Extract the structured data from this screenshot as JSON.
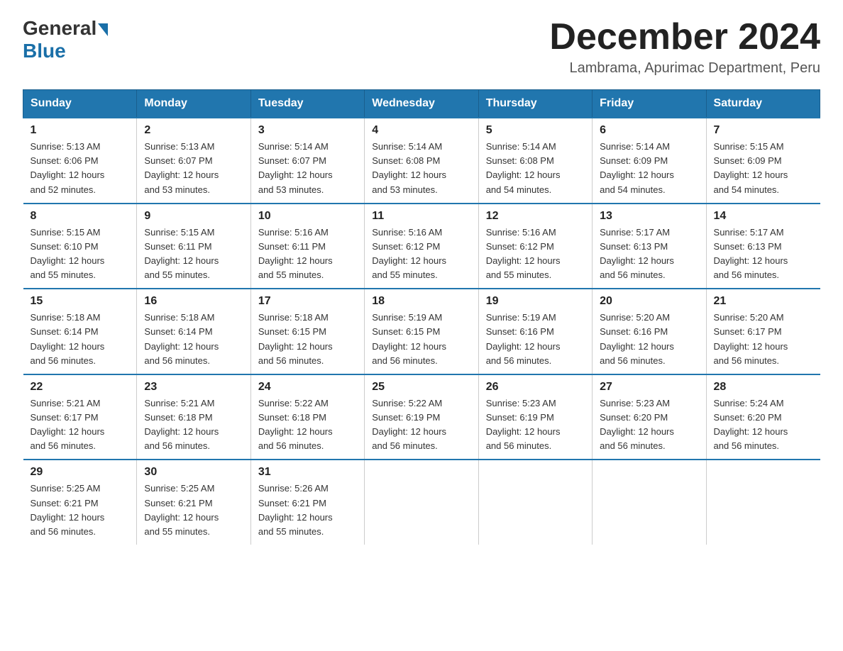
{
  "header": {
    "logo_general": "General",
    "logo_blue": "Blue",
    "title": "December 2024",
    "subtitle": "Lambrama, Apurimac Department, Peru"
  },
  "days_of_week": [
    "Sunday",
    "Monday",
    "Tuesday",
    "Wednesday",
    "Thursday",
    "Friday",
    "Saturday"
  ],
  "weeks": [
    [
      {
        "day": "1",
        "sunrise": "5:13 AM",
        "sunset": "6:06 PM",
        "daylight": "12 hours and 52 minutes."
      },
      {
        "day": "2",
        "sunrise": "5:13 AM",
        "sunset": "6:07 PM",
        "daylight": "12 hours and 53 minutes."
      },
      {
        "day": "3",
        "sunrise": "5:14 AM",
        "sunset": "6:07 PM",
        "daylight": "12 hours and 53 minutes."
      },
      {
        "day": "4",
        "sunrise": "5:14 AM",
        "sunset": "6:08 PM",
        "daylight": "12 hours and 53 minutes."
      },
      {
        "day": "5",
        "sunrise": "5:14 AM",
        "sunset": "6:08 PM",
        "daylight": "12 hours and 54 minutes."
      },
      {
        "day": "6",
        "sunrise": "5:14 AM",
        "sunset": "6:09 PM",
        "daylight": "12 hours and 54 minutes."
      },
      {
        "day": "7",
        "sunrise": "5:15 AM",
        "sunset": "6:09 PM",
        "daylight": "12 hours and 54 minutes."
      }
    ],
    [
      {
        "day": "8",
        "sunrise": "5:15 AM",
        "sunset": "6:10 PM",
        "daylight": "12 hours and 55 minutes."
      },
      {
        "day": "9",
        "sunrise": "5:15 AM",
        "sunset": "6:11 PM",
        "daylight": "12 hours and 55 minutes."
      },
      {
        "day": "10",
        "sunrise": "5:16 AM",
        "sunset": "6:11 PM",
        "daylight": "12 hours and 55 minutes."
      },
      {
        "day": "11",
        "sunrise": "5:16 AM",
        "sunset": "6:12 PM",
        "daylight": "12 hours and 55 minutes."
      },
      {
        "day": "12",
        "sunrise": "5:16 AM",
        "sunset": "6:12 PM",
        "daylight": "12 hours and 55 minutes."
      },
      {
        "day": "13",
        "sunrise": "5:17 AM",
        "sunset": "6:13 PM",
        "daylight": "12 hours and 56 minutes."
      },
      {
        "day": "14",
        "sunrise": "5:17 AM",
        "sunset": "6:13 PM",
        "daylight": "12 hours and 56 minutes."
      }
    ],
    [
      {
        "day": "15",
        "sunrise": "5:18 AM",
        "sunset": "6:14 PM",
        "daylight": "12 hours and 56 minutes."
      },
      {
        "day": "16",
        "sunrise": "5:18 AM",
        "sunset": "6:14 PM",
        "daylight": "12 hours and 56 minutes."
      },
      {
        "day": "17",
        "sunrise": "5:18 AM",
        "sunset": "6:15 PM",
        "daylight": "12 hours and 56 minutes."
      },
      {
        "day": "18",
        "sunrise": "5:19 AM",
        "sunset": "6:15 PM",
        "daylight": "12 hours and 56 minutes."
      },
      {
        "day": "19",
        "sunrise": "5:19 AM",
        "sunset": "6:16 PM",
        "daylight": "12 hours and 56 minutes."
      },
      {
        "day": "20",
        "sunrise": "5:20 AM",
        "sunset": "6:16 PM",
        "daylight": "12 hours and 56 minutes."
      },
      {
        "day": "21",
        "sunrise": "5:20 AM",
        "sunset": "6:17 PM",
        "daylight": "12 hours and 56 minutes."
      }
    ],
    [
      {
        "day": "22",
        "sunrise": "5:21 AM",
        "sunset": "6:17 PM",
        "daylight": "12 hours and 56 minutes."
      },
      {
        "day": "23",
        "sunrise": "5:21 AM",
        "sunset": "6:18 PM",
        "daylight": "12 hours and 56 minutes."
      },
      {
        "day": "24",
        "sunrise": "5:22 AM",
        "sunset": "6:18 PM",
        "daylight": "12 hours and 56 minutes."
      },
      {
        "day": "25",
        "sunrise": "5:22 AM",
        "sunset": "6:19 PM",
        "daylight": "12 hours and 56 minutes."
      },
      {
        "day": "26",
        "sunrise": "5:23 AM",
        "sunset": "6:19 PM",
        "daylight": "12 hours and 56 minutes."
      },
      {
        "day": "27",
        "sunrise": "5:23 AM",
        "sunset": "6:20 PM",
        "daylight": "12 hours and 56 minutes."
      },
      {
        "day": "28",
        "sunrise": "5:24 AM",
        "sunset": "6:20 PM",
        "daylight": "12 hours and 56 minutes."
      }
    ],
    [
      {
        "day": "29",
        "sunrise": "5:25 AM",
        "sunset": "6:21 PM",
        "daylight": "12 hours and 56 minutes."
      },
      {
        "day": "30",
        "sunrise": "5:25 AM",
        "sunset": "6:21 PM",
        "daylight": "12 hours and 55 minutes."
      },
      {
        "day": "31",
        "sunrise": "5:26 AM",
        "sunset": "6:21 PM",
        "daylight": "12 hours and 55 minutes."
      },
      null,
      null,
      null,
      null
    ]
  ],
  "labels": {
    "sunrise": "Sunrise:",
    "sunset": "Sunset:",
    "daylight": "Daylight:"
  },
  "colors": {
    "header_bg": "#2176ae",
    "header_text": "#ffffff",
    "border": "#2176ae",
    "title": "#222222",
    "subtitle": "#555555"
  }
}
